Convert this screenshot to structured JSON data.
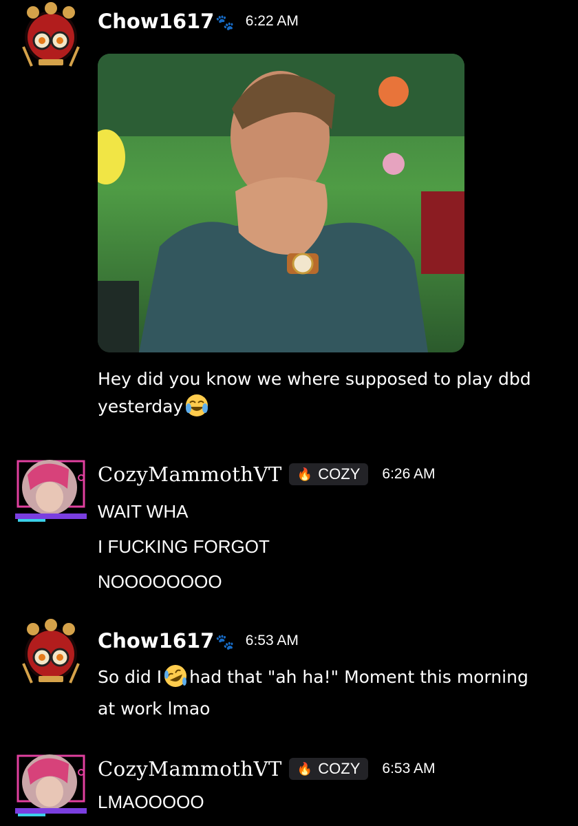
{
  "colors": {
    "background": "#000000",
    "text": "#ffffff",
    "tag_bg": "#232327",
    "paw": "#b7651f",
    "fire": "#f36b2a"
  },
  "messages": [
    {
      "username": "Chow1617",
      "badge_icon": "paw-prints-icon",
      "time": "6:22 AM",
      "attachment": "gif-man-laughing-covering-mouth",
      "lines": [
        "Hey did you know we where supposed to play dbd",
        "yesterday"
      ],
      "emoji": "joy-emoji"
    },
    {
      "username": "CozyMammothVT",
      "tag": "COZY",
      "tag_icon": "fire-icon",
      "time": "6:26 AM",
      "lines": [
        "WAIT WHA",
        "I FUCKING FORGOT",
        "NOOOOOOOO"
      ]
    },
    {
      "username": "Chow1617",
      "badge_icon": "paw-prints-icon",
      "time": "6:53 AM",
      "text_before_emoji": "So did I",
      "emoji": "rofl-emoji",
      "text_after_emoji": "had that \"ah ha!\" Moment this morning",
      "line2": "at work lmao"
    },
    {
      "username": "CozyMammothVT",
      "tag": "COZY",
      "tag_icon": "fire-icon",
      "time": "6:53 AM",
      "lines": [
        "LMAOOOOO"
      ]
    }
  ]
}
